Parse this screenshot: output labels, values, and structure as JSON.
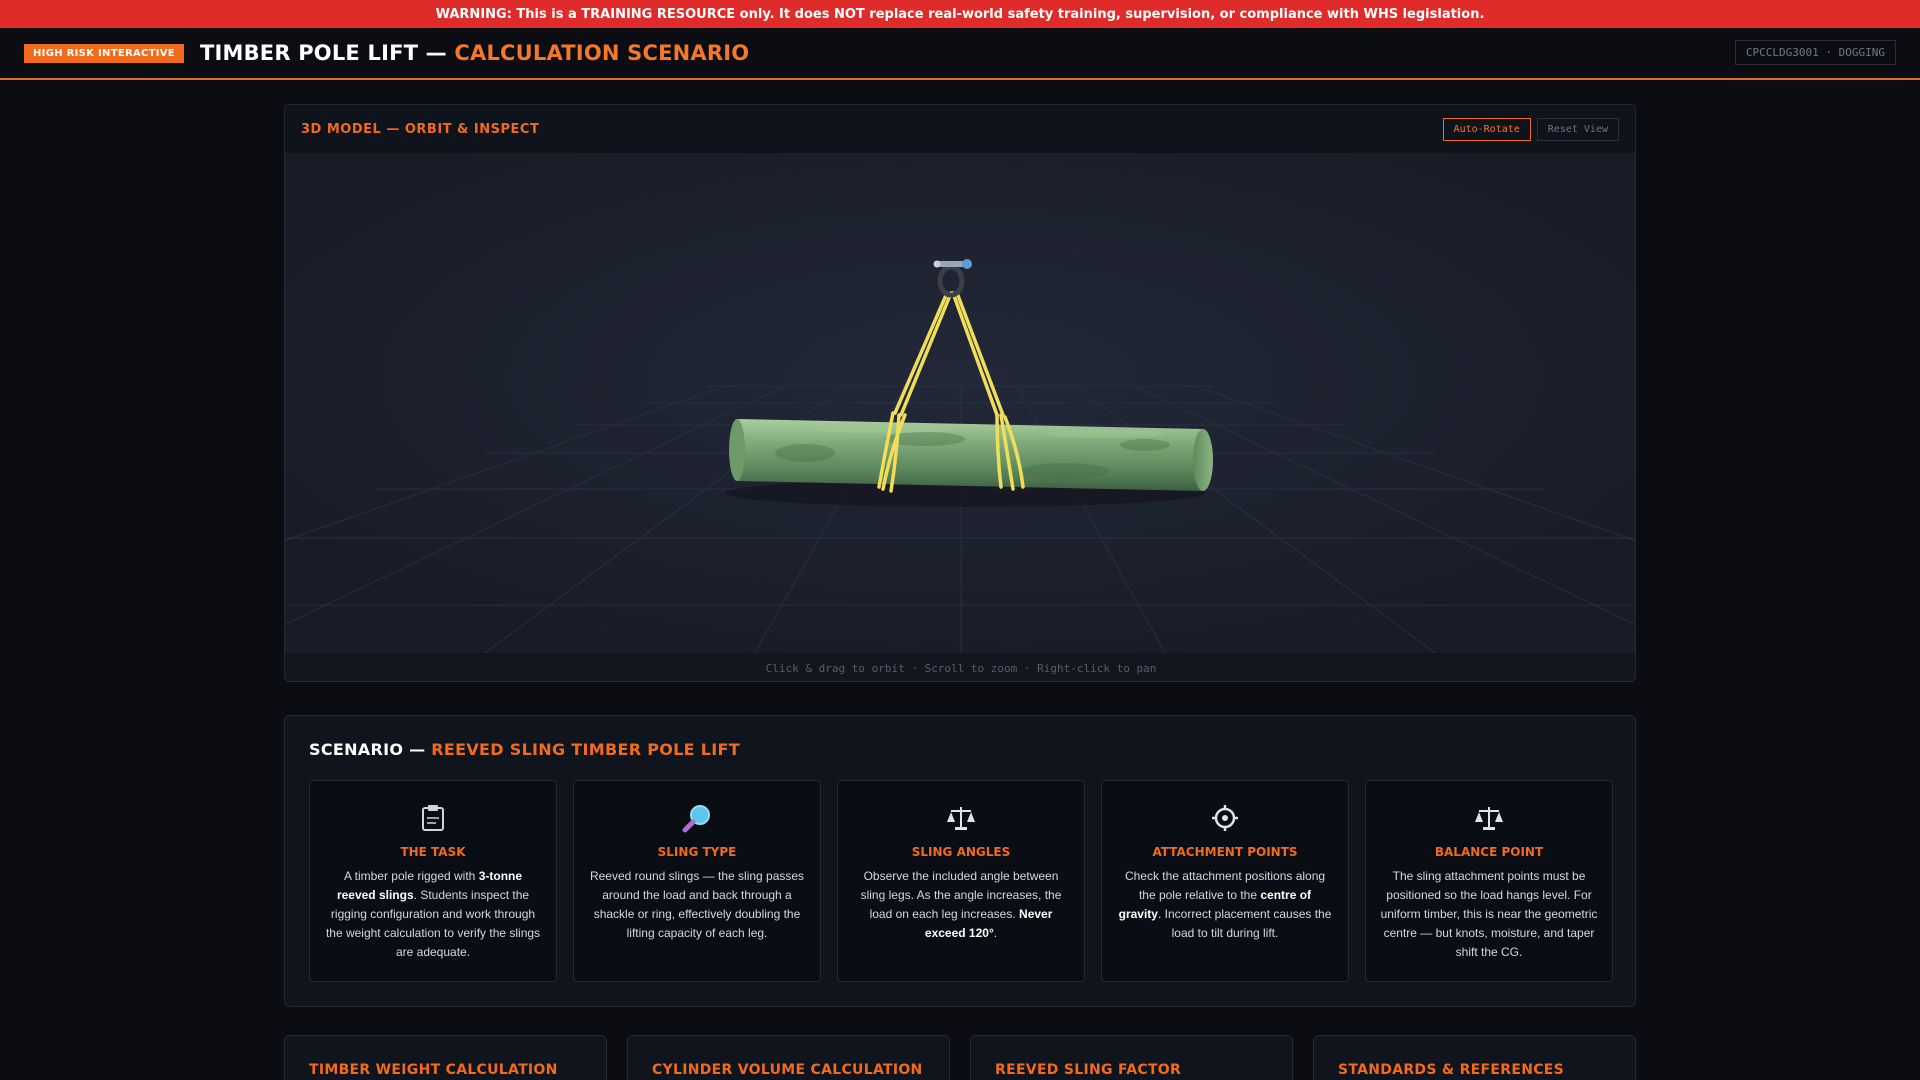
{
  "warning": "WARNING: This is a TRAINING RESOURCE only. It does NOT replace real-world safety training, supervision, or compliance with WHS legislation.",
  "header": {
    "badge": "High Risk Interactive",
    "title_main": "TIMBER POLE LIFT — ",
    "title_accent": "CALCULATION SCENARIO",
    "course_code": "CPCCLDG3001 · DOGGING"
  },
  "viewer": {
    "label": "3D Model — Orbit & Inspect",
    "auto_rotate": "Auto-Rotate",
    "reset_view": "Reset View",
    "hint": "Click & drag to orbit · Scroll to zoom · Right-click to pan"
  },
  "scenario": {
    "title_main": "SCENARIO — ",
    "title_accent": "REEVED SLING TIMBER POLE LIFT",
    "cards": [
      {
        "icon": "clipboard-icon",
        "title": "The Task",
        "pre": "A timber pole rigged with ",
        "bold": "3-tonne reeved slings",
        "post": ". Students inspect the rigging configuration and work through the weight calculation to verify the slings are adequate."
      },
      {
        "icon": "magnifier-icon",
        "title": "Sling Type",
        "pre": "Reeved round slings — the sling passes around the load and back through a shackle or ring, effectively doubling the lifting capacity of each leg.",
        "bold": "",
        "post": ""
      },
      {
        "icon": "scales-icon",
        "title": "Sling Angles",
        "pre": "Observe the included angle between sling legs. As the angle increases, the load on each leg increases. ",
        "bold": "Never exceed 120°",
        "post": "."
      },
      {
        "icon": "target-icon",
        "title": "Attachment Points",
        "pre": "Check the attachment positions along the pole relative to the ",
        "bold": "centre of gravity",
        "post": ". Incorrect placement causes the load to tilt during lift."
      },
      {
        "icon": "balance-icon",
        "title": "Balance Point",
        "pre": "The sling attachment points must be positioned so the load hangs level. For uniform timber, this is near the geometric centre — but knots, moisture, and taper shift the CG.",
        "bold": "",
        "post": ""
      }
    ]
  },
  "bottom_panels": [
    "Timber Weight Calculation",
    "Cylinder Volume Calculation",
    "Reeved Sling Factor",
    "Standards & References"
  ],
  "colors": {
    "accent": "#f26b1d",
    "warning": "#e02b2b",
    "sling": "#f0de5a",
    "pole": "#6f9a6a"
  }
}
